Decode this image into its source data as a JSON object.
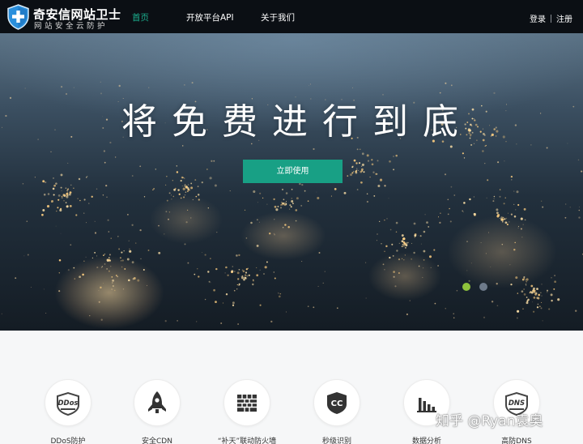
{
  "header": {
    "logo_title": "奇安信网站卫士",
    "logo_subtitle": "网站安全云防护",
    "nav": [
      {
        "label": "首页",
        "active": true
      },
      {
        "label": "开放平台API",
        "active": false
      },
      {
        "label": "关于我们",
        "active": false
      }
    ],
    "login_label": "登录",
    "register_label": "注册"
  },
  "hero": {
    "title": "将免费进行到底",
    "button_label": "立即使用",
    "carousel_dots": [
      {
        "color": "#8fc33c",
        "active": true
      },
      {
        "color": "#6d7a8a",
        "active": false
      }
    ]
  },
  "features": [
    {
      "label": "DDoS防护",
      "icon": "ddos-shield-icon"
    },
    {
      "label": "安全CDN",
      "icon": "rocket-icon"
    },
    {
      "label": "“补天”联动防火墙",
      "icon": "brick-wall-icon"
    },
    {
      "label": "秒级识别",
      "icon": "cc-shield-icon"
    },
    {
      "label": "数据分析",
      "icon": "bar-chart-icon"
    },
    {
      "label": "高防DNS",
      "icon": "dns-shield-icon"
    }
  ],
  "colors": {
    "accent": "#18a085",
    "nav_active": "#1bb08f",
    "header_bg": "#0b0f14"
  },
  "watermark": "知乎 @Ryan袁奥"
}
